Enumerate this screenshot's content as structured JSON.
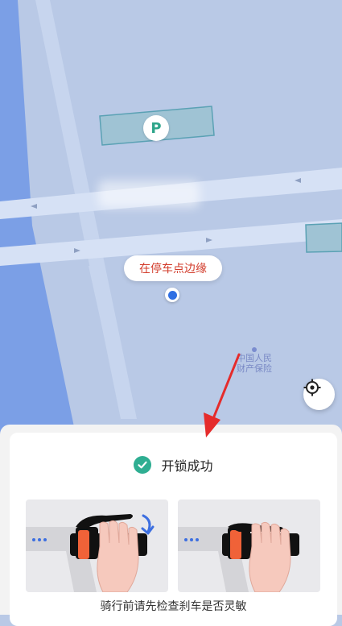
{
  "map": {
    "parking_marker": "P",
    "road_label": "",
    "edge_hint": "在停车点边缘",
    "poi_label_line1": "中国人民",
    "poi_label_line2": "财产保险",
    "locate_icon": "crosshair-icon",
    "location_icon": "user-location-icon"
  },
  "sheet": {
    "status_text": "开锁成功",
    "status_icon": "check-circle-icon",
    "caption": "骑行前请先检查刹车是否灵敏"
  },
  "colors": {
    "map_bg": "#b9c9e6",
    "road": "#d6e1f5",
    "river": "#7b9fe6",
    "parking_zone": "#9fc3d4",
    "accent_green": "#2fae92",
    "edge_hint_red": "#d23b2a",
    "annotation_red": "#e52b2b"
  }
}
